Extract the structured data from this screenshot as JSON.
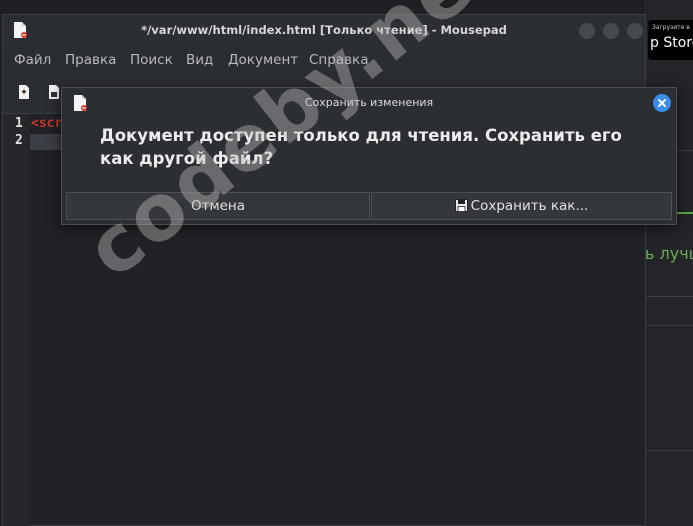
{
  "window": {
    "title": "*/var/www/html/index.html [Только чтение] - Mousepad"
  },
  "menu": [
    "Файл",
    "Правка",
    "Поиск",
    "Вид",
    "Документ",
    "Справка"
  ],
  "editor": {
    "line_numbers": [
      "1",
      "2"
    ],
    "line1_text": "<scr"
  },
  "dialog": {
    "title": "Сохранить изменения",
    "message": "Документ доступен только для чтения. Сохранить его как другой файл?",
    "cancel_label": "Отмена",
    "save_as_label": "Сохранить как..."
  },
  "background": {
    "appstore_small": "Загрузите в",
    "appstore_big": "p Store",
    "partial_text": "ь лучш"
  },
  "watermark": "codeby.net",
  "colors": {
    "accent_blue": "#3b8ee6",
    "keyword_red": "#c0392b",
    "green": "#5ba84a"
  }
}
